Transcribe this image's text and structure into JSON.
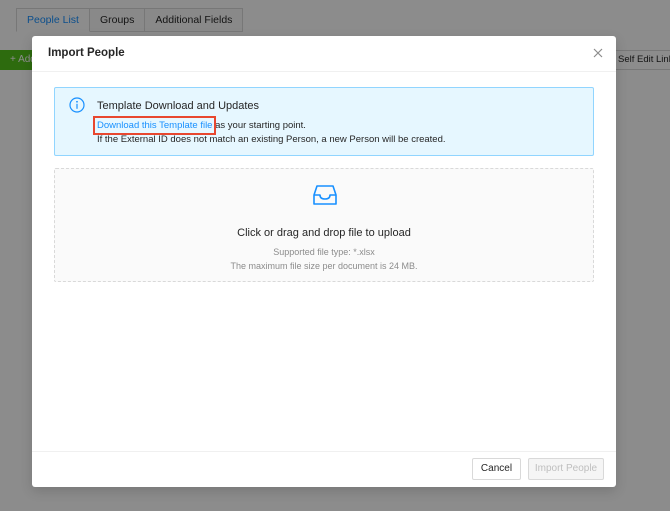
{
  "background": {
    "tabs": [
      {
        "label": "People List"
      },
      {
        "label": "Groups"
      },
      {
        "label": "Additional Fields"
      }
    ],
    "add_button_label": "+ Add",
    "self_edit_label": "Self Edit Link"
  },
  "modal": {
    "title": "Import People",
    "alert": {
      "title": "Template Download and Updates",
      "link_text": "Download this Template file",
      "line1_suffix": " as your starting point.",
      "line2": "If the External ID does not match an existing Person, a new Person will be created."
    },
    "dropzone": {
      "title": "Click or drag and drop file to upload",
      "hint1": "Supported file type: *.xlsx",
      "hint2": "The maximum file size per document is 24 MB."
    },
    "footer": {
      "cancel_label": "Cancel",
      "import_label": "Import People"
    }
  },
  "colors": {
    "accent": "#1890ff",
    "highlight_box": "#e8472f",
    "alert_bg": "#e6f7ff",
    "add_button": "#52c41a"
  },
  "icons": {
    "close": "close-icon",
    "info": "info-icon",
    "upload": "inbox-icon"
  }
}
